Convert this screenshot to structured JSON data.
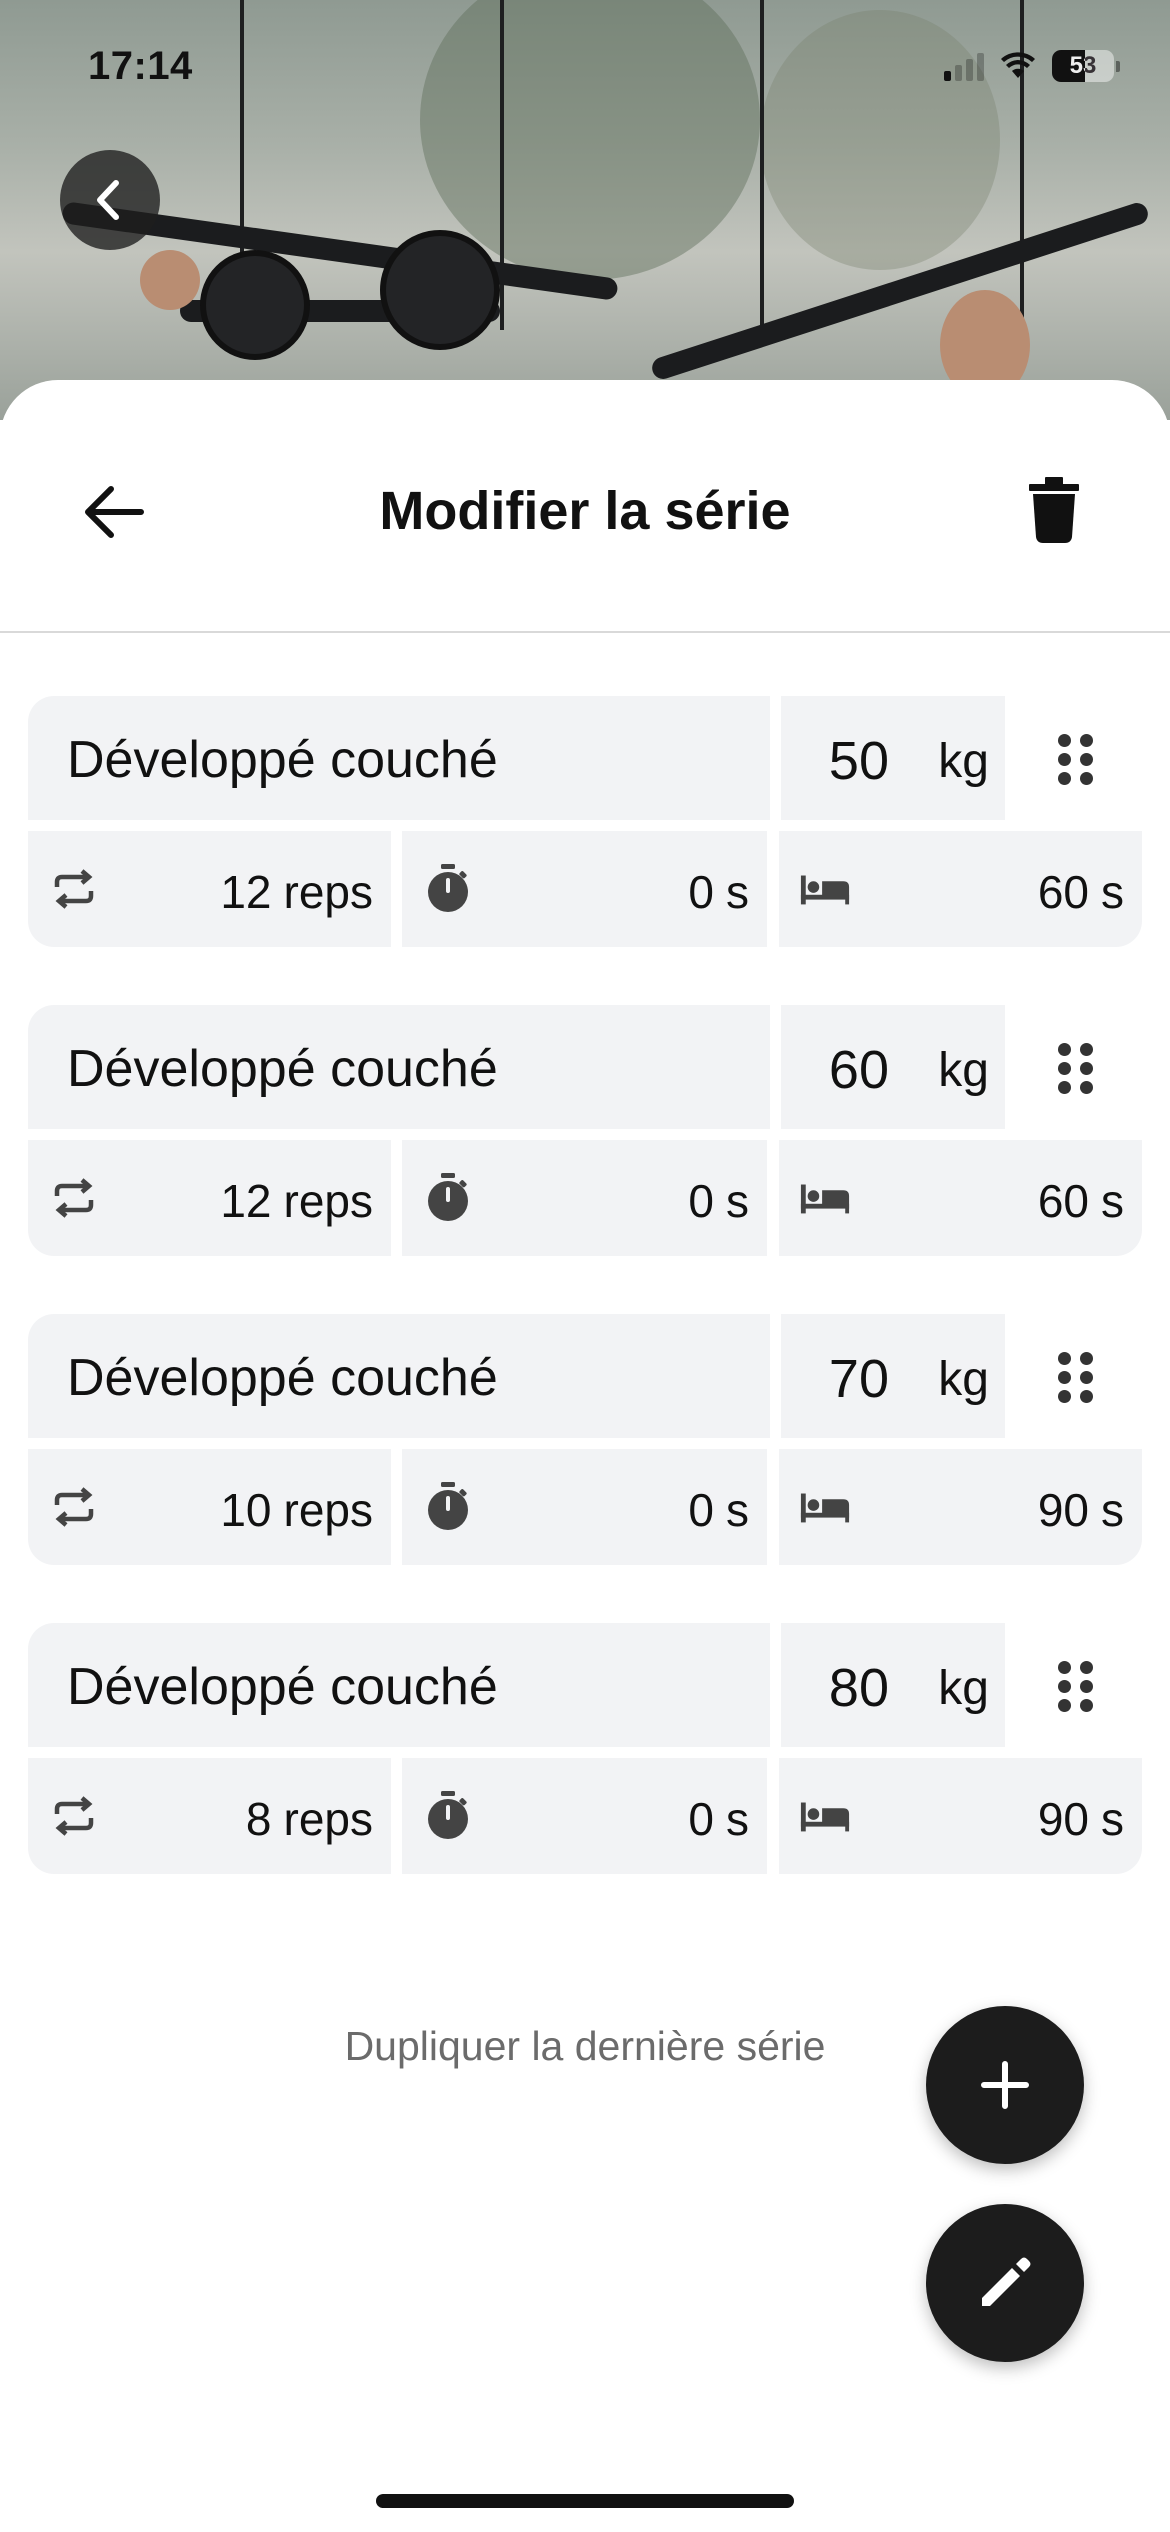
{
  "status_bar": {
    "time": "17:14",
    "battery": "53",
    "battery_level": 0.53
  },
  "header": {
    "title": "Modifier la série"
  },
  "sets": [
    {
      "exercise": "Développé couché",
      "weight": "50",
      "weight_unit": "kg",
      "reps": "12",
      "reps_unit": "reps",
      "time": "0",
      "time_unit": "s",
      "rest": "60",
      "rest_unit": "s"
    },
    {
      "exercise": "Développé couché",
      "weight": "60",
      "weight_unit": "kg",
      "reps": "12",
      "reps_unit": "reps",
      "time": "0",
      "time_unit": "s",
      "rest": "60",
      "rest_unit": "s"
    },
    {
      "exercise": "Développé couché",
      "weight": "70",
      "weight_unit": "kg",
      "reps": "10",
      "reps_unit": "reps",
      "time": "0",
      "time_unit": "s",
      "rest": "90",
      "rest_unit": "s"
    },
    {
      "exercise": "Développé couché",
      "weight": "80",
      "weight_unit": "kg",
      "reps": "8",
      "reps_unit": "reps",
      "time": "0",
      "time_unit": "s",
      "rest": "90",
      "rest_unit": "s"
    }
  ],
  "actions": {
    "duplicate_label": "Dupliquer la dernière série"
  },
  "icons": {
    "back": "arrow-left-icon",
    "delete": "trash-icon",
    "reps": "repeat-icon",
    "time": "stopwatch-icon",
    "rest": "bed-icon",
    "drag": "drag-handle-icon",
    "add": "plus-icon",
    "edit": "pencil-icon"
  }
}
